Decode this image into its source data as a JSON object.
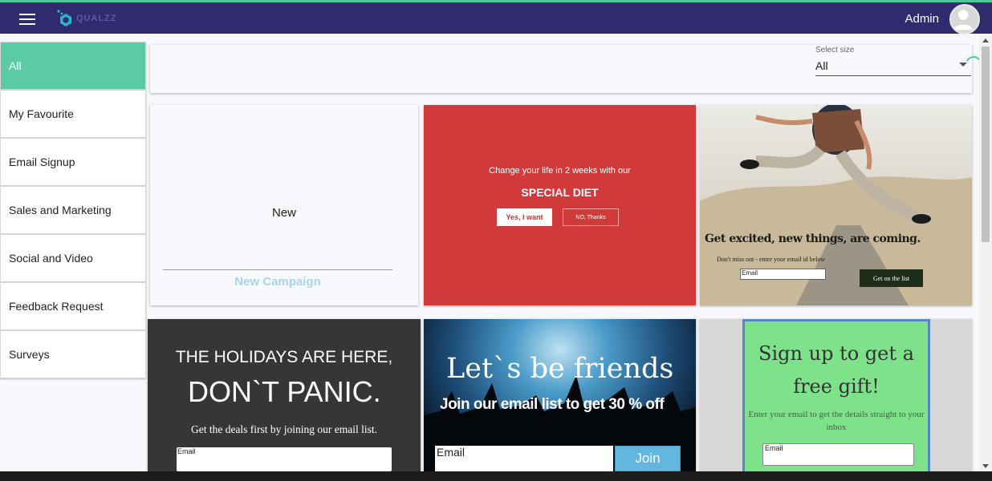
{
  "header": {
    "brand": "QUALZZ",
    "user": "Admin"
  },
  "sidebar": {
    "items": [
      {
        "label": "All"
      },
      {
        "label": "My Favourite"
      },
      {
        "label": "Email Signup"
      },
      {
        "label": "Sales and Marketing"
      },
      {
        "label": "Social and Video"
      },
      {
        "label": "Feedback Request"
      },
      {
        "label": "Surveys"
      }
    ]
  },
  "filter": {
    "label": "Select size",
    "value": "All"
  },
  "cards": {
    "new": {
      "title": "New",
      "cta": "New Campaign"
    },
    "diet": {
      "line1": "Change your life in 2 weeks with our",
      "line2": "SPECIAL DIET",
      "yes": "Yes, I want",
      "no": "NO, Thanks"
    },
    "excited": {
      "headline": "Get excited, new things, are coming.",
      "sub": "Don't miss out - enter your email id below",
      "placeholder": "Email",
      "button": "Get on the list"
    },
    "holidays": {
      "line1": "THE HOLIDAYS ARE HERE,",
      "line2": "DON`T PANIC.",
      "body": "Get the deals first by joining our email list.",
      "placeholder": "Email"
    },
    "friends": {
      "headline": "Let`s be friends",
      "body": "Join our email list to get 30 % off",
      "placeholder": "Email",
      "button": "Join"
    },
    "gift": {
      "headline": "Sign up to get a free gift!",
      "body": "Enter your email to get the details straight to your inbox",
      "placeholder": "Email"
    }
  }
}
